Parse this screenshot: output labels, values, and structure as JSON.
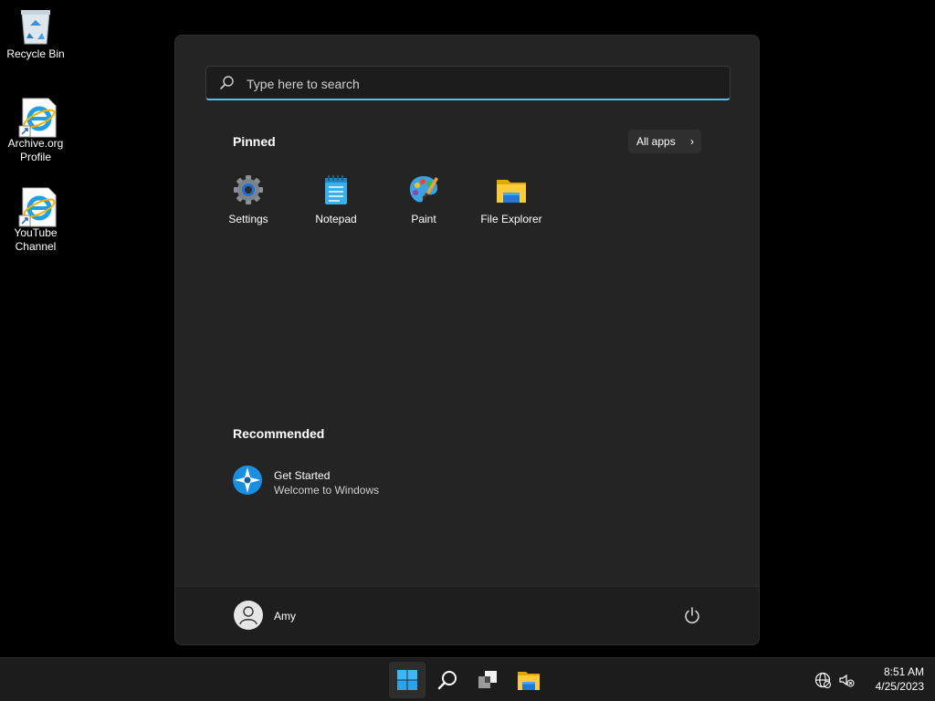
{
  "desktop": {
    "icons": [
      {
        "label": "Recycle Bin",
        "icon": "recycle-bin-icon"
      },
      {
        "label": "Archive.org\nProfile",
        "icon": "internet-explorer-shortcut-icon"
      },
      {
        "label": "YouTube\nChannel",
        "icon": "internet-explorer-shortcut-icon"
      }
    ]
  },
  "start_menu": {
    "search": {
      "placeholder": "Type here to search",
      "value": ""
    },
    "pinned_title": "Pinned",
    "all_apps_label": "All apps",
    "pinned": [
      {
        "label": "Settings",
        "icon": "settings-gear-icon"
      },
      {
        "label": "Notepad",
        "icon": "notepad-icon"
      },
      {
        "label": "Paint",
        "icon": "paint-palette-icon"
      },
      {
        "label": "File Explorer",
        "icon": "folder-icon"
      }
    ],
    "recommended_title": "Recommended",
    "recommended": [
      {
        "title": "Get Started",
        "subtitle": "Welcome to Windows",
        "icon": "get-started-icon"
      }
    ],
    "user": {
      "name": "Amy"
    }
  },
  "taskbar": {
    "items": [
      "start-icon",
      "search-icon",
      "task-view-icon",
      "file-explorer-icon"
    ],
    "tray": [
      "globe-network-icon",
      "speaker-muted-icon"
    ],
    "clock": {
      "time": "8:51 AM",
      "date": "4/25/2023"
    }
  },
  "colors": {
    "accent": "#4cc2ff",
    "menu_bg": "#242424",
    "taskbar_bg": "#1c1c1c"
  }
}
